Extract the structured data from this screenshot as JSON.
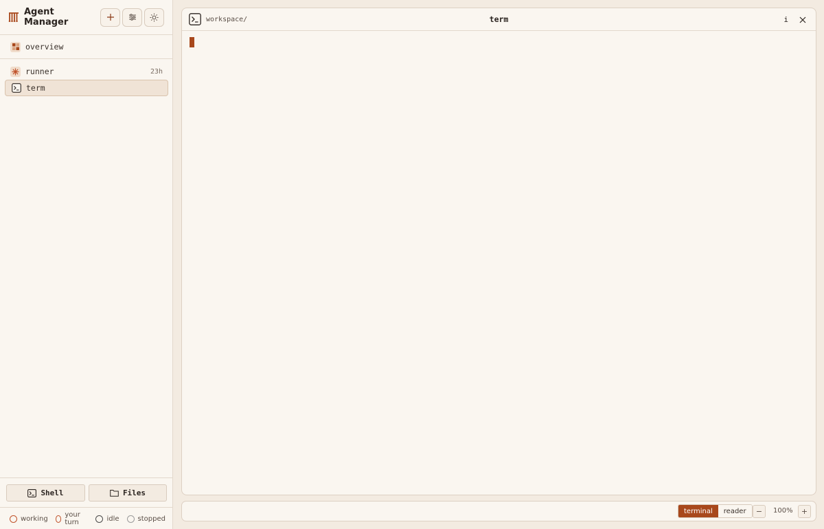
{
  "app": {
    "title": "Agent Manager"
  },
  "sidebar": {
    "overview": {
      "label": "overview"
    },
    "sessions": [
      {
        "label": "runner",
        "time": "23h",
        "icon": "asterisk-icon"
      },
      {
        "label": "term",
        "time": "",
        "icon": "terminal-icon"
      }
    ],
    "buttons": {
      "shell": "Shell",
      "files": "Files"
    },
    "legend": [
      {
        "label": "working",
        "color": "#c0522a"
      },
      {
        "label": "your turn",
        "color": "#c0522a"
      },
      {
        "label": "idle",
        "color": "#4a4a4a"
      },
      {
        "label": "stopped",
        "color": "#9a9a9a"
      }
    ]
  },
  "panel": {
    "path": "workspace/",
    "title": "term",
    "info": "i"
  },
  "bottombar": {
    "modes": {
      "terminal": "terminal",
      "reader": "reader"
    },
    "zoom": "100%",
    "zoom_out": "−",
    "zoom_in": "+"
  },
  "colors": {
    "accent": "#a8481c",
    "background": "#f3ebe1",
    "panel": "#faf6f0"
  }
}
